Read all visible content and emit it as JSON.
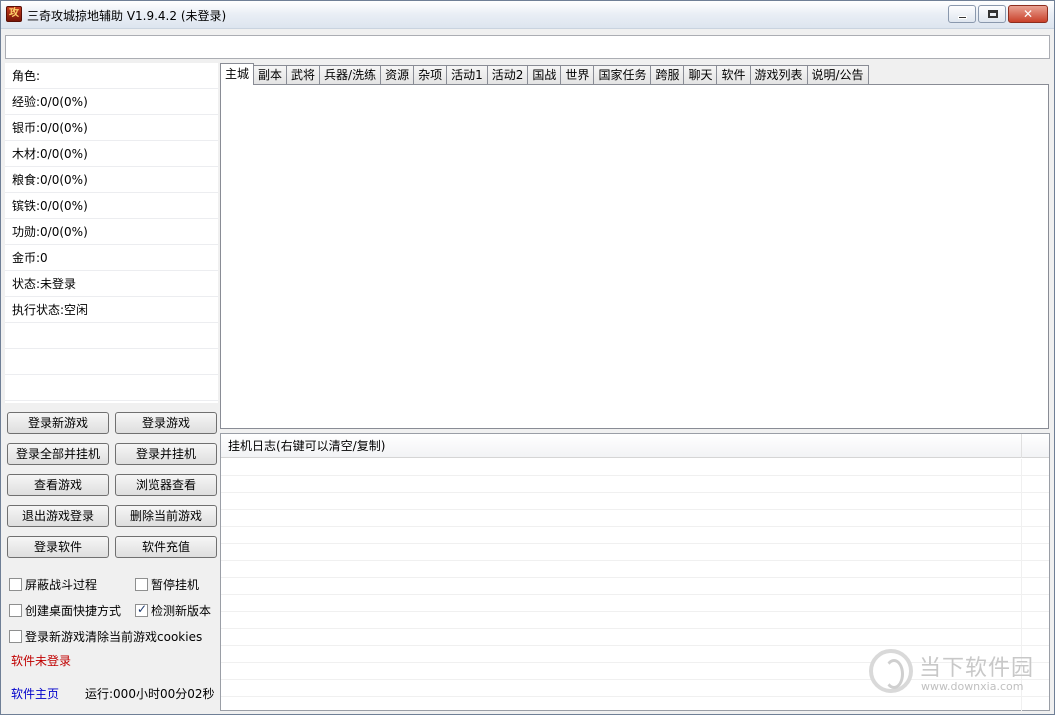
{
  "window": {
    "title": "三奇攻城掠地辅助 V1.9.4.2 (未登录)",
    "icon_text": "攻"
  },
  "address_bar": {
    "value": ""
  },
  "info": [
    "角色:",
    "经验:0/0(0%)",
    "银币:0/0(0%)",
    "木材:0/0(0%)",
    "粮食:0/0(0%)",
    "镔铁:0/0(0%)",
    "功勋:0/0(0%)",
    "金币:0",
    "状态:未登录",
    "执行状态:空闲",
    "",
    "",
    ""
  ],
  "buttons": {
    "login_new_game": "登录新游戏",
    "login_game": "登录游戏",
    "login_all_and_idle": "登录全部并挂机",
    "login_and_idle": "登录并挂机",
    "view_game": "查看游戏",
    "browser_view": "浏览器查看",
    "logout_game": "退出游戏登录",
    "delete_current_game": "删除当前游戏",
    "login_software": "登录软件",
    "software_recharge": "软件充值"
  },
  "checkboxes": {
    "hide_battle": {
      "label": "屏蔽战斗过程",
      "checked": false
    },
    "pause_idle": {
      "label": "暂停挂机",
      "checked": false
    },
    "desktop_shortcut": {
      "label": "创建桌面快捷方式",
      "checked": false
    },
    "check_version": {
      "label": "检测新版本",
      "checked": true
    },
    "clear_cookies": {
      "label": "登录新游戏清除当前游戏cookies",
      "checked": false
    }
  },
  "status": {
    "software_state": "软件未登录",
    "home_link": "软件主页",
    "runtime": "运行:000小时00分02秒"
  },
  "tabs": [
    "主城",
    "副本",
    "武将",
    "兵器/洗练",
    "资源",
    "杂项",
    "活动1",
    "活动2",
    "国战",
    "世界",
    "国家任务",
    "跨服",
    "聊天",
    "软件",
    "游戏列表",
    "说明/公告"
  ],
  "active_tab": 0,
  "log": {
    "header": "挂机日志(右键可以清空/复制)"
  },
  "watermark": {
    "cn": "当下软件园",
    "url": "www.downxia.com"
  },
  "colors": {
    "status_red": "#c00000",
    "link_blue": "#0000cc"
  }
}
